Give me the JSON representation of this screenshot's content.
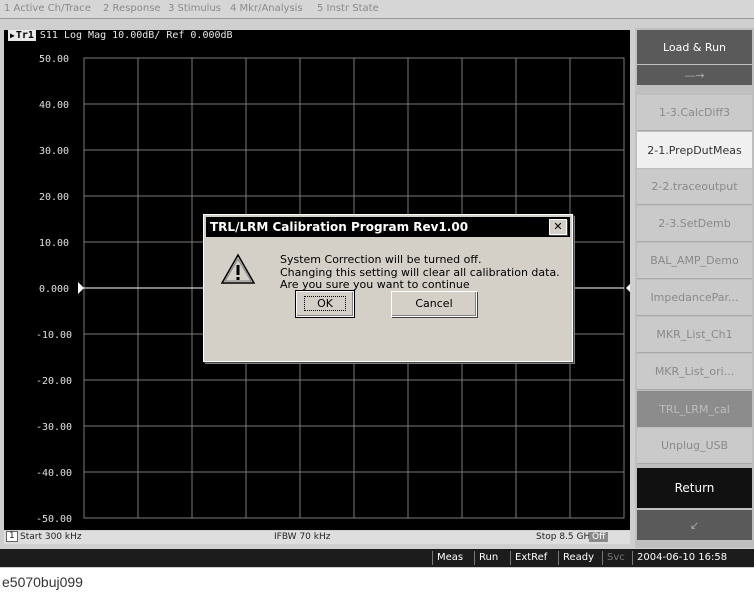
{
  "menu": [
    "1 Active Ch/Trace",
    "2 Response",
    "3 Stimulus",
    "4 Mkr/Analysis",
    "5 Instr State"
  ],
  "chart": {
    "trace_tag": "Tr1",
    "header": "S11 Log Mag 10.00dB/ Ref 0.000dB",
    "y_ticks": [
      "50.00",
      "40.00",
      "30.00",
      "20.00",
      "10.00",
      "0.000",
      "-10.00",
      "-20.00",
      "-30.00",
      "-40.00",
      "-50.00"
    ],
    "channel": "1",
    "start": "Start 300 kHz",
    "ifbw": "IFBW 70 kHz",
    "stop": "Stop 8.5 GHz",
    "off": "Off"
  },
  "chart_data": {
    "type": "line",
    "title": "S11 Log Mag 10.00dB/ Ref 0.000dB",
    "ylim": [
      -50,
      50
    ],
    "y_ticks": [
      50,
      40,
      30,
      20,
      10,
      0,
      -10,
      -20,
      -30,
      -40,
      -50
    ],
    "grid": true,
    "series": [
      {
        "values": [
          0,
          0
        ]
      }
    ],
    "xlim_labels": [
      "Start 300 kHz",
      "Stop 8.5 GHz"
    ]
  },
  "softkeys": [
    "Load & Run",
    "1-3.CalcDiff3",
    "2-1.PrepDutMeas",
    "2-2.traceoutput",
    "2-3.SetDemb",
    "BAL_AMP_Demo",
    "ImpedancePar...",
    "MKR_List_Ch1",
    "MKR_List_ori...",
    "TRL_LRM_cal",
    "Unplug_USB",
    "Return"
  ],
  "softkey_arrows": {
    "up": "—→",
    "down": "↙"
  },
  "status": {
    "meas": "Meas",
    "run": "Run",
    "extref": "ExtRef",
    "ready": "Ready",
    "svc": "Svc",
    "datetime": "2004-06-10 16:58"
  },
  "dialog": {
    "title": "TRL/LRM Calibration Program  Rev1.00",
    "close": "✕",
    "lines": [
      "System Correction will be turned off.",
      "Changing this setting will clear all calibration data.",
      "Are you sure you want to continue"
    ],
    "ok": "OK",
    "cancel": "Cancel",
    "icon": "warning-icon"
  },
  "caption": "e5070buj099",
  "colors": {
    "chart_bg": "#000000",
    "grid": "#7a7a7a",
    "trace": "#ffffff",
    "dialog_title": "#000000",
    "dialog_bg": "#d4d0c8"
  }
}
